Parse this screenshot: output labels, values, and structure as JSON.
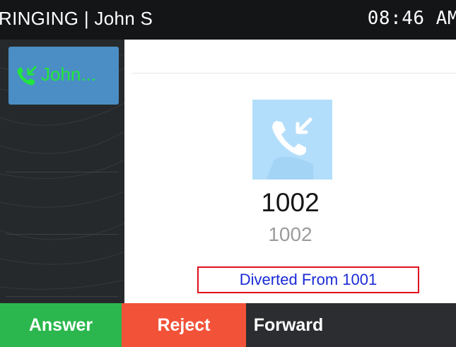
{
  "status_bar": {
    "title": "RINGING | John S",
    "time": "08:46 AM"
  },
  "line_panel": {
    "active_line": {
      "label": "John...",
      "icon": "incoming-call-icon",
      "label_color": "#21e63c",
      "background_color": "#4a8ec5"
    }
  },
  "call": {
    "caller_name": "1002",
    "caller_number": "1002",
    "diverted_text": "Diverted From 1001",
    "avatar_icon": "incoming-call-icon"
  },
  "softkeys": [
    {
      "label": "Answer",
      "color": "#2bb74d"
    },
    {
      "label": "Reject",
      "color": "#f25238"
    },
    {
      "label": "Forward",
      "color": "#2b2d30"
    }
  ]
}
